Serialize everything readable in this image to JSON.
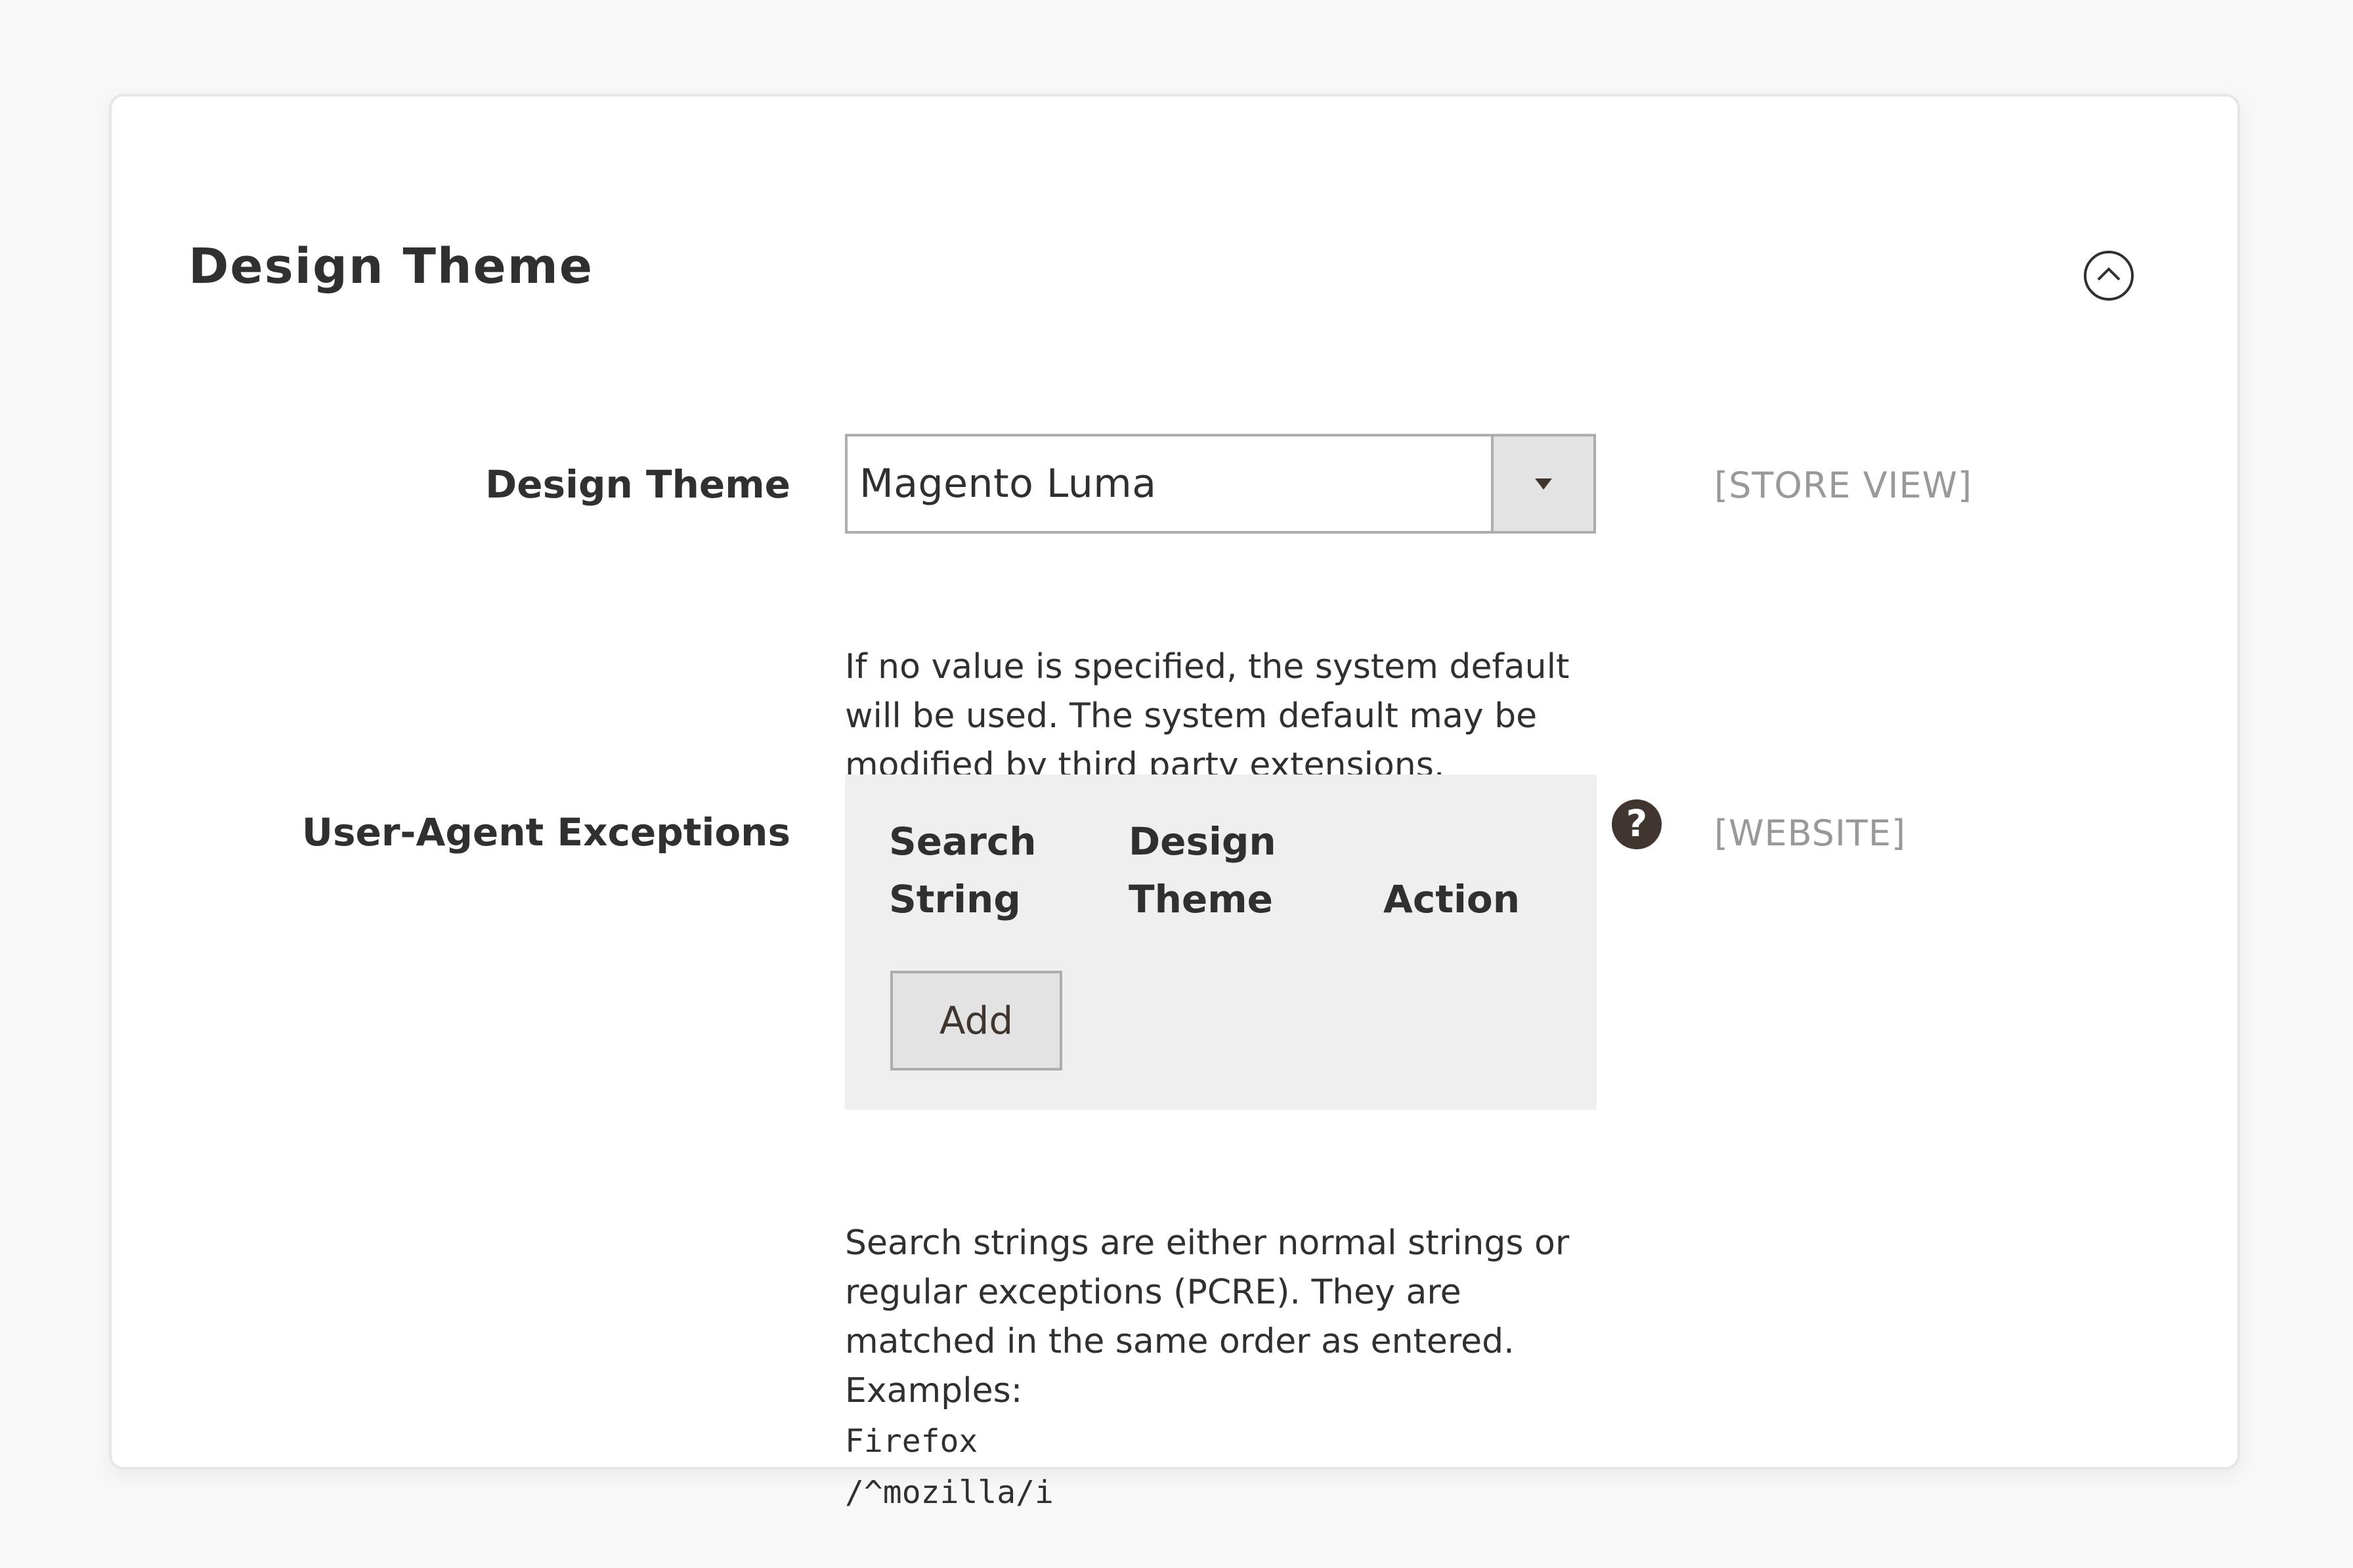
{
  "section": {
    "title": "Design Theme",
    "collapse_icon": "chevron-up-circle-icon"
  },
  "design_theme_field": {
    "label": "Design Theme",
    "selected_value": "Magento Luma",
    "scope": "[STORE VIEW]",
    "note": "If no value is specified, the system default will be used. The system default may be modified by third party extensions."
  },
  "ua_exceptions_field": {
    "label": "User-Agent Exceptions",
    "columns": [
      {
        "line1": "Search",
        "line2": "String"
      },
      {
        "line1": "Design",
        "line2": "Theme"
      },
      {
        "line1": "Action"
      }
    ],
    "add_button": "Add",
    "help_icon": "question-circle-icon",
    "help_glyph": "?",
    "scope": "[WEBSITE]",
    "note_text": "Search strings are either normal strings or regular exceptions (PCRE). They are matched in the same order as entered.",
    "examples_label": "Examples:",
    "examples": [
      "Firefox",
      "/^mozilla/i"
    ]
  },
  "colors": {
    "page_bg": "#f8f8f8",
    "card_bg": "#ffffff",
    "text": "#303030",
    "scope_text": "#999999",
    "table_bg": "#efefef",
    "button_bg": "#e3e3e3",
    "border": "#adadad",
    "icon_dark": "#41362f"
  }
}
